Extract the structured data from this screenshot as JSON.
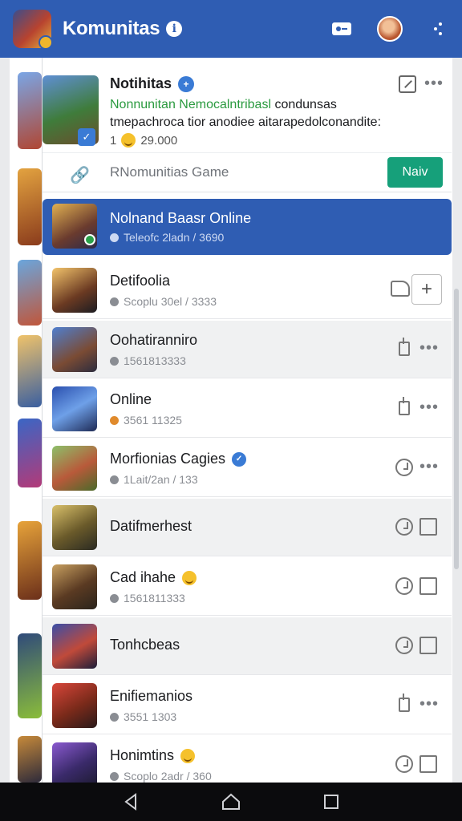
{
  "header": {
    "title": "Komunitas",
    "icons": [
      "app-logo-icon",
      "info-icon",
      "key-icon",
      "profile-avatar",
      "more-vert-icon"
    ]
  },
  "featured": {
    "name": "Notihitas",
    "line1_green": "Nonnunitan Nemocalntribasl",
    "line1_rest": " condunsas",
    "line2": "tmepachroca tior anodiee aitarapedolconandite:",
    "stats_prefix": "1",
    "stats_value": "29.000",
    "subtitle": "RNomunitias Game",
    "button_label": "Naiv"
  },
  "selected": {
    "name": "Nolnand Baasr Online",
    "meta": "Teleofc 2ladn / 3690"
  },
  "rows": [
    {
      "name": "Detifoolia",
      "meta": "Scoplu 30el / 3333"
    },
    {
      "name": "Oohatiranniro",
      "meta": "1561813333"
    },
    {
      "name": "Online",
      "meta": "3561 11325"
    },
    {
      "name": "Morfionias Cagies",
      "meta": "1Lait/2an / 133"
    },
    {
      "name": "Datifmerhest",
      "meta": ""
    },
    {
      "name": "Cad ihahe",
      "meta": "1561811333"
    },
    {
      "name": "Tonhcbeas",
      "meta": ""
    },
    {
      "name": "Enifiemanios",
      "meta": "3551 1303"
    },
    {
      "name": "Honimtins",
      "meta": "Scoplo 2adr / 360"
    }
  ],
  "colors": {
    "header": "#2f5db3",
    "selected": "#2f5db3",
    "button": "#16a07a",
    "green_text": "#2a9a3f"
  }
}
